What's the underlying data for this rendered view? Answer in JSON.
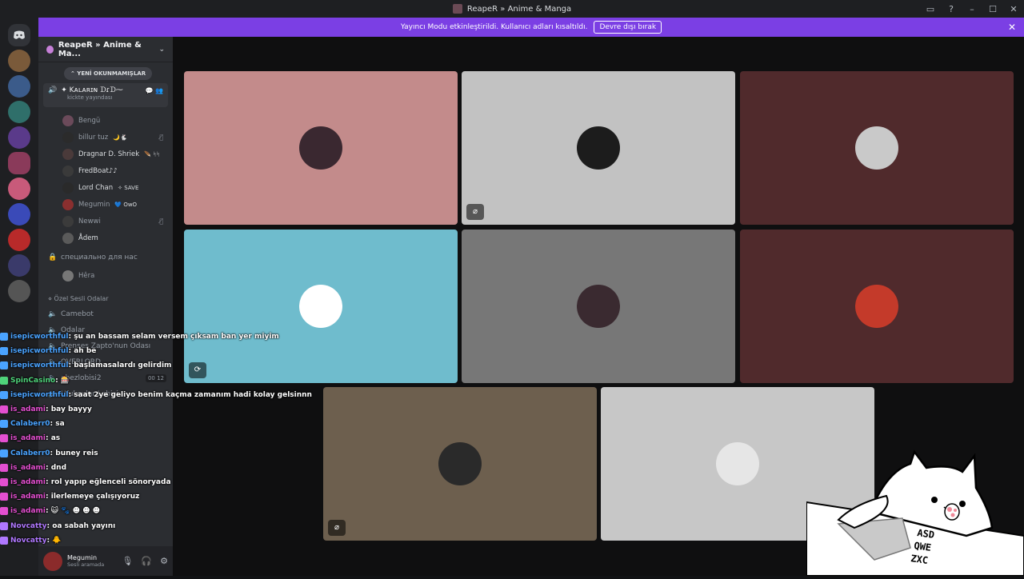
{
  "window": {
    "title": "ReapeR » Anime & Manga",
    "controls": [
      "▭",
      "?",
      "–",
      "☐",
      "✕"
    ]
  },
  "banner": {
    "text": "Yayıncı Modu etkinleştirildi. Kullanıcı adları kısaltıldı.",
    "button": "Devre dışı bırak",
    "close": "✕"
  },
  "server": {
    "name": "ReapeR » Anime & Ma...",
    "chevron": "⌄"
  },
  "channels": {
    "new_unread": "⌃ YENİ OKUNMAMIŞLAR",
    "active_voice": {
      "name": "✦ Kᴀʟᴀʀɪɴ ᗪɾᗪ⁓",
      "status": "kickte yayındası"
    },
    "members": [
      {
        "name": "Bengü",
        "badge": "",
        "color": "#6b4a5a",
        "bright": false,
        "muted": false
      },
      {
        "name": "billur tuz",
        "badge": "🌙🐇",
        "color": "#2b2b2b",
        "bright": false,
        "muted": true
      },
      {
        "name": "Dragnar D. Shriek",
        "badge": "🪶 ᛋᛋ",
        "color": "#4a3a3a",
        "bright": true,
        "muted": false
      },
      {
        "name": "FredBoat♪♪",
        "badge": "",
        "color": "#3a3a3a",
        "bright": true,
        "muted": false
      },
      {
        "name": "Lord Chan",
        "badge": "✧ SAVE",
        "color": "#2a2a2a",
        "bright": true,
        "muted": false
      },
      {
        "name": "Megumin",
        "badge": "💙 OwO",
        "color": "#8a2f2f",
        "bright": false,
        "muted": false
      },
      {
        "name": "Newwi",
        "badge": "",
        "color": "#3b3b3b",
        "bright": false,
        "muted": true
      },
      {
        "name": "Ådem",
        "badge": "",
        "color": "#5a5a5a",
        "bright": true,
        "muted": false
      }
    ],
    "locked_channel": "специально для нас",
    "locked_member": "Hêra",
    "category": "⋄ Özel Sesli Odalar",
    "more": [
      {
        "name": "Camebot"
      },
      {
        "name": "Odalar"
      },
      {
        "name": "Prenses Zapto'nun Odası"
      },
      {
        "name": "OVERLORD"
      },
      {
        "name": "obezlobisi2",
        "count": "00 12"
      },
      {
        "name": "Ufukçular Lobisi"
      }
    ]
  },
  "user": {
    "name": "Megumin",
    "status": "Sesli aramada",
    "controls": [
      "🎙",
      "🎧",
      "⚙"
    ]
  },
  "tiles": [
    {
      "bg": "#c38b8b",
      "avatar": "#3a2830"
    },
    {
      "bg": "#c2c2c2",
      "avatar": "#1c1c1c",
      "mic": "⌀"
    },
    {
      "bg": "#502a2c",
      "avatar": "#c9c9c9"
    },
    {
      "bg": "#6fbccd",
      "avatar": "#ffffff",
      "mic": "⟳"
    },
    {
      "bg": "#777777",
      "avatar": "#3a2a30"
    },
    {
      "bg": "#502a2c",
      "avatar": "#c43a2a"
    },
    {
      "bg": "#6d5f4e",
      "avatar": "#2a2a2a",
      "mic": "⌀"
    },
    {
      "bg": "#c7c7c7",
      "avatar": "#e6e6e6"
    }
  ],
  "chat": [
    {
      "user": "isepicworthful",
      "msg": " : şu an bassam selam versem çıksam ban yer miyim",
      "color": "#4aa3ff"
    },
    {
      "user": "isepicworthful",
      "msg": " : ah be",
      "color": "#4aa3ff"
    },
    {
      "user": "isepicworthful",
      "msg": " : başlamasalardı gelirdim",
      "color": "#4aa3ff"
    },
    {
      "user": "SpinCasino",
      "msg": " : 🎰",
      "color": "#4fd37a"
    },
    {
      "user": "isepicworthful",
      "msg": " : saat 2ye geliyo benim kaçma zamanım hadi kolay gelsinnn",
      "color": "#4aa3ff"
    },
    {
      "user": "is_adami",
      "msg": " : bay bayyy",
      "color": "#e34fd0"
    },
    {
      "user": "Calaberr0",
      "msg": " : sa",
      "color": "#4aa3ff"
    },
    {
      "user": "is_adami",
      "msg": " : as",
      "color": "#e34fd0"
    },
    {
      "user": "Calaberr0",
      "msg": " : buney reis",
      "color": "#4aa3ff"
    },
    {
      "user": "is_adami",
      "msg": " : dnd",
      "color": "#e34fd0"
    },
    {
      "user": "is_adami",
      "msg": " : rol yapıp eğlenceli sönoryada",
      "color": "#e34fd0"
    },
    {
      "user": "is_adami",
      "msg": " : ilerlemeye çalışıyoruz",
      "color": "#e34fd0"
    },
    {
      "user": "is_adami",
      "msg": " : 😺 🐾 ☻ ☻ ☻",
      "color": "#e34fd0"
    },
    {
      "user": "Novcatty",
      "msg": " : oa sabah yayını",
      "color": "#b078ff"
    },
    {
      "user": "Novcatty",
      "msg": " : 🐥",
      "color": "#b078ff"
    }
  ],
  "keyboard_keys": [
    "ASD",
    "QWE",
    "ZXC"
  ]
}
